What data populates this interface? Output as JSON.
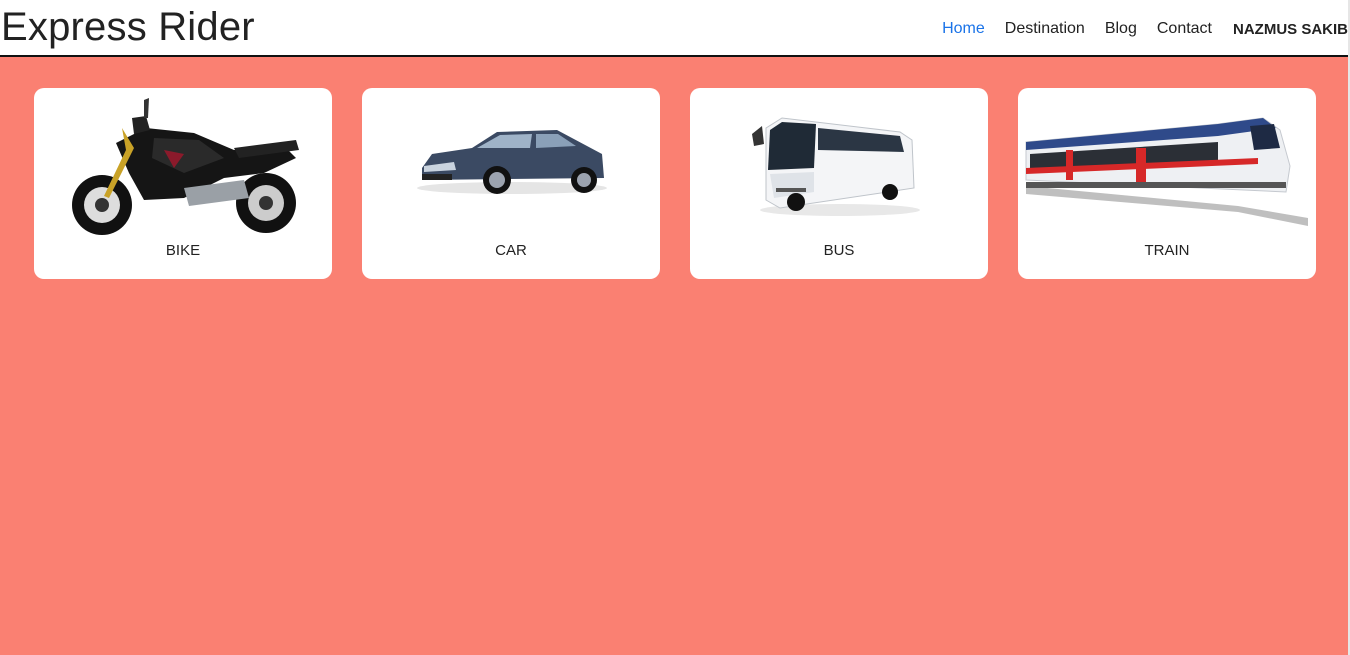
{
  "brand": "Express Rider",
  "nav": {
    "items": [
      "Home",
      "Destination",
      "Blog",
      "Contact"
    ],
    "active": "Home",
    "user": "NAZMUS SAKIB"
  },
  "vehicles": [
    {
      "label": "BIKE",
      "icon": "motorcycle-image"
    },
    {
      "label": "CAR",
      "icon": "car-image"
    },
    {
      "label": "BUS",
      "icon": "bus-image"
    },
    {
      "label": "TRAIN",
      "icon": "train-image"
    }
  ],
  "colors": {
    "background": "#fa8072",
    "active_link": "#1a73e8"
  }
}
